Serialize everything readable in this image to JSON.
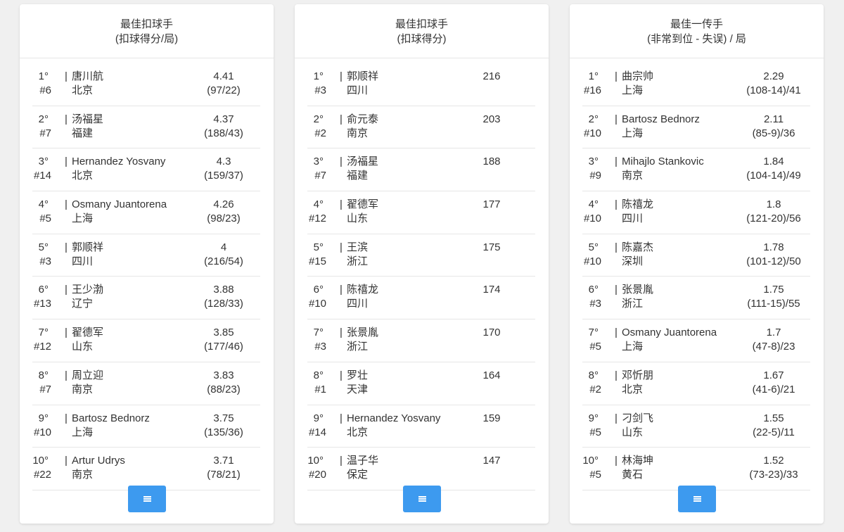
{
  "cards": [
    {
      "title": "最佳扣球手",
      "subtitle": "(扣球得分/局)",
      "rows": [
        {
          "rank": "1°",
          "num": "#6",
          "name": "唐川航",
          "city": "北京",
          "value": "4.41",
          "detail": "(97/22)"
        },
        {
          "rank": "2°",
          "num": "#7",
          "name": "汤福星",
          "city": "福建",
          "value": "4.37",
          "detail": "(188/43)"
        },
        {
          "rank": "3°",
          "num": "#14",
          "name": "Hernandez Yosvany",
          "city": "北京",
          "value": "4.3",
          "detail": "(159/37)"
        },
        {
          "rank": "4°",
          "num": "#5",
          "name": "Osmany Juantorena",
          "city": "上海",
          "value": "4.26",
          "detail": "(98/23)"
        },
        {
          "rank": "5°",
          "num": "#3",
          "name": "郭顺祥",
          "city": "四川",
          "value": "4",
          "detail": "(216/54)"
        },
        {
          "rank": "6°",
          "num": "#13",
          "name": "王少渤",
          "city": "辽宁",
          "value": "3.88",
          "detail": "(128/33)"
        },
        {
          "rank": "7°",
          "num": "#12",
          "name": "翟德军",
          "city": "山东",
          "value": "3.85",
          "detail": "(177/46)"
        },
        {
          "rank": "8°",
          "num": "#7",
          "name": "周立迎",
          "city": "南京",
          "value": "3.83",
          "detail": "(88/23)"
        },
        {
          "rank": "9°",
          "num": "#10",
          "name": "Bartosz Bednorz",
          "city": "上海",
          "value": "3.75",
          "detail": "(135/36)"
        },
        {
          "rank": "10°",
          "num": "#22",
          "name": "Artur Udrys",
          "city": "南京",
          "value": "3.71",
          "detail": "(78/21)"
        }
      ]
    },
    {
      "title": "最佳扣球手",
      "subtitle": "(扣球得分)",
      "rows": [
        {
          "rank": "1°",
          "num": "#3",
          "name": "郭顺祥",
          "city": "四川",
          "value": "216",
          "detail": ""
        },
        {
          "rank": "2°",
          "num": "#2",
          "name": "俞元泰",
          "city": "南京",
          "value": "203",
          "detail": ""
        },
        {
          "rank": "3°",
          "num": "#7",
          "name": "汤福星",
          "city": "福建",
          "value": "188",
          "detail": ""
        },
        {
          "rank": "4°",
          "num": "#12",
          "name": "翟德军",
          "city": "山东",
          "value": "177",
          "detail": ""
        },
        {
          "rank": "5°",
          "num": "#15",
          "name": "王滨",
          "city": "浙江",
          "value": "175",
          "detail": ""
        },
        {
          "rank": "6°",
          "num": "#10",
          "name": "陈禧龙",
          "city": "四川",
          "value": "174",
          "detail": ""
        },
        {
          "rank": "7°",
          "num": "#3",
          "name": "张景胤",
          "city": "浙江",
          "value": "170",
          "detail": ""
        },
        {
          "rank": "8°",
          "num": "#1",
          "name": "罗壮",
          "city": "天津",
          "value": "164",
          "detail": ""
        },
        {
          "rank": "9°",
          "num": "#14",
          "name": "Hernandez Yosvany",
          "city": "北京",
          "value": "159",
          "detail": ""
        },
        {
          "rank": "10°",
          "num": "#20",
          "name": "温子华",
          "city": "保定",
          "value": "147",
          "detail": ""
        }
      ]
    },
    {
      "title": "最佳一传手",
      "subtitle": "(非常到位 - 失误) / 局",
      "rows": [
        {
          "rank": "1°",
          "num": "#16",
          "name": "曲宗帅",
          "city": "上海",
          "value": "2.29",
          "detail": "(108-14)/41"
        },
        {
          "rank": "2°",
          "num": "#10",
          "name": "Bartosz Bednorz",
          "city": "上海",
          "value": "2.11",
          "detail": "(85-9)/36"
        },
        {
          "rank": "3°",
          "num": "#9",
          "name": "Mihajlo Stankovic",
          "city": "南京",
          "value": "1.84",
          "detail": "(104-14)/49"
        },
        {
          "rank": "4°",
          "num": "#10",
          "name": "陈禧龙",
          "city": "四川",
          "value": "1.8",
          "detail": "(121-20)/56"
        },
        {
          "rank": "5°",
          "num": "#10",
          "name": "陈嘉杰",
          "city": "深圳",
          "value": "1.78",
          "detail": "(101-12)/50"
        },
        {
          "rank": "6°",
          "num": "#3",
          "name": "张景胤",
          "city": "浙江",
          "value": "1.75",
          "detail": "(111-15)/55"
        },
        {
          "rank": "7°",
          "num": "#5",
          "name": "Osmany Juantorena",
          "city": "上海",
          "value": "1.7",
          "detail": "(47-8)/23"
        },
        {
          "rank": "8°",
          "num": "#2",
          "name": "邓忻朋",
          "city": "北京",
          "value": "1.67",
          "detail": "(41-6)/21"
        },
        {
          "rank": "9°",
          "num": "#5",
          "name": "刁剑飞",
          "city": "山东",
          "value": "1.55",
          "detail": "(22-5)/11"
        },
        {
          "rank": "10°",
          "num": "#5",
          "name": "林海坤",
          "city": "黄石",
          "value": "1.52",
          "detail": "(73-23)/33"
        }
      ]
    }
  ],
  "separator": "|",
  "menu_icon": "menu-lines-icon",
  "accent_color": "#3d9aef"
}
